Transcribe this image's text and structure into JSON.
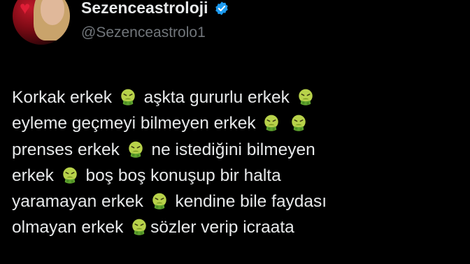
{
  "profile": {
    "display_name": "Sezenceastroloji",
    "handle": "@Sezenceastrolo1",
    "verified": true,
    "verified_color": "#1d9bf0"
  },
  "tweet": {
    "lines": [
      [
        "Korkak erkek ",
        "nauseated-face",
        " aşkta gururlu erkek ",
        "nauseated-face"
      ],
      [
        "eyleme geçmeyi bilmeyen erkek ",
        "nauseated-face",
        " ",
        "nauseated-face"
      ],
      [
        "prenses erkek ",
        "nauseated-face",
        " ne istediğini bilmeyen"
      ],
      [
        "erkek ",
        "nauseated-face",
        " boş boş konuşup bir halta"
      ],
      [
        "yaramayan erkek ",
        "nauseated-face",
        " kendine bile faydası"
      ],
      [
        "olmayan erkek ",
        "nauseated-face",
        "sözler verip icraata"
      ]
    ]
  },
  "colors": {
    "background": "#000000",
    "text": "#e7e9ea",
    "secondary_text": "#71767b"
  }
}
